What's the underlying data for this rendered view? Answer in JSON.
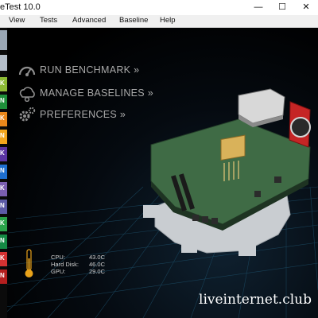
{
  "window": {
    "title": "eTest 10.0",
    "minimize_glyph": "—",
    "maximize_glyph": "☐",
    "close_glyph": "✕"
  },
  "menu": [
    {
      "label": "View"
    },
    {
      "label": "Tests"
    },
    {
      "label": "Advanced"
    },
    {
      "label": "Baseline"
    },
    {
      "label": "Help"
    }
  ],
  "sidebar": {
    "tiles": [
      {
        "letter": "",
        "color": "#9aa7b5"
      },
      {
        "letter": "",
        "color": "#b4bec9"
      },
      {
        "letter": "K",
        "color": "#8dbb35"
      },
      {
        "letter": "N",
        "color": "#1e8f3a"
      },
      {
        "letter": "K",
        "color": "#e9871b"
      },
      {
        "letter": "N",
        "color": "#f2a51c"
      },
      {
        "letter": "K",
        "color": "#5b35a3"
      },
      {
        "letter": "N",
        "color": "#1e6fd0"
      },
      {
        "letter": "K",
        "color": "#7b5fb0"
      },
      {
        "letter": "N",
        "color": "#5c5aa6"
      },
      {
        "letter": "K",
        "color": "#2aa34a"
      },
      {
        "letter": "N",
        "color": "#148a44"
      },
      {
        "letter": "K",
        "color": "#d53232"
      },
      {
        "letter": "N",
        "color": "#b51f1f"
      }
    ]
  },
  "actions": [
    {
      "label": "RUN BENCHMARK »",
      "icon": "gauge-icon"
    },
    {
      "label": "MANAGE BASELINES »",
      "icon": "cloud-gear-icon"
    },
    {
      "label": "PREFERENCES »",
      "icon": "gears-icon"
    }
  ],
  "temps": [
    {
      "label": "CPU:",
      "value": "43.0C"
    },
    {
      "label": "Hard Disk:",
      "value": "46.0C"
    },
    {
      "label": "GPU:",
      "value": "29.0C"
    }
  ],
  "watermark": "liveinternet.club",
  "colors": {
    "accent": "#a9a9a9",
    "thermometer": "#e8a21a",
    "gear": "#c9cdd1",
    "board": "#3f6b45"
  }
}
